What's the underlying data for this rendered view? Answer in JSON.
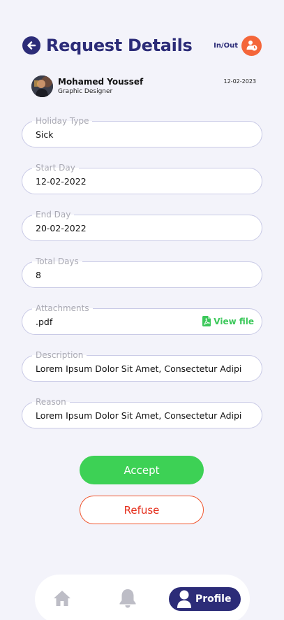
{
  "header": {
    "title": "Request Details",
    "inout_label": "In/Out"
  },
  "user": {
    "name": "Mohamed Youssef",
    "role": "Graphic Designer",
    "date": "12-02-2023"
  },
  "fields": [
    {
      "label": "Holiday Type",
      "value": "Sick"
    },
    {
      "label": "Start Day",
      "value": "12-02-2022"
    },
    {
      "label": "End Day",
      "value": "20-02-2022"
    },
    {
      "label": "Total Days",
      "value": "8"
    },
    {
      "label": "Attachments",
      "value": ".pdf",
      "action": "View file"
    },
    {
      "label": "Description",
      "value": "Lorem Ipsum Dolor Sit Amet, Consectetur Adipi"
    },
    {
      "label": "Reason",
      "value": "Lorem Ipsum Dolor Sit Amet, Consectetur Adipi"
    }
  ],
  "actions": {
    "accept": "Accept",
    "refuse": "Refuse"
  },
  "nav": {
    "profile_label": "Profile"
  },
  "colors": {
    "primary": "#2c2c78",
    "accent": "#f4663a",
    "success": "#3dd155",
    "danger": "#e52d1a",
    "background": "#f3f3fa"
  },
  "icons": {
    "back": "arrow-left-icon",
    "inout": "user-clock-icon",
    "pdf": "pdf-file-icon",
    "home": "home-icon",
    "bell": "bell-icon",
    "profile": "user-icon"
  }
}
